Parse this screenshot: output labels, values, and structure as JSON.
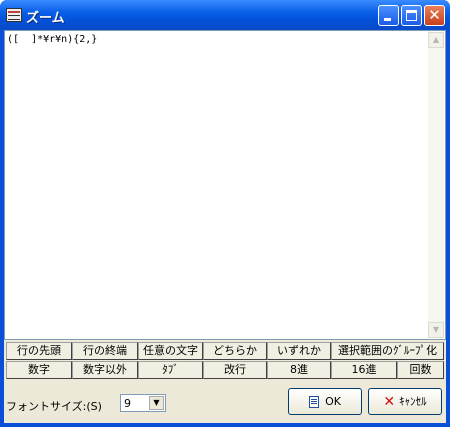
{
  "window": {
    "title": "ズーム"
  },
  "editor": {
    "content": "([  ]*¥r¥n){2,}"
  },
  "regex_buttons": {
    "row1": [
      "行の先頭",
      "行の終端",
      "任意の文字",
      "どちらか",
      "いずれか",
      "選択範囲のｸﾞﾙｰﾌﾟ化"
    ],
    "row2": [
      "数字",
      "数字以外",
      "ﾀﾌﾞ",
      "改行",
      "8進",
      "16進",
      "回数"
    ]
  },
  "font_size": {
    "label": "フォントサイズ:(S)",
    "value": "9"
  },
  "dialog_buttons": {
    "ok_label": "OK",
    "cancel_label": "ｷｬﾝｾﾙ"
  },
  "colors": {
    "titlebar": "#0a5fe8",
    "face": "#ece9d8",
    "cancel_icon": "#d01010"
  }
}
